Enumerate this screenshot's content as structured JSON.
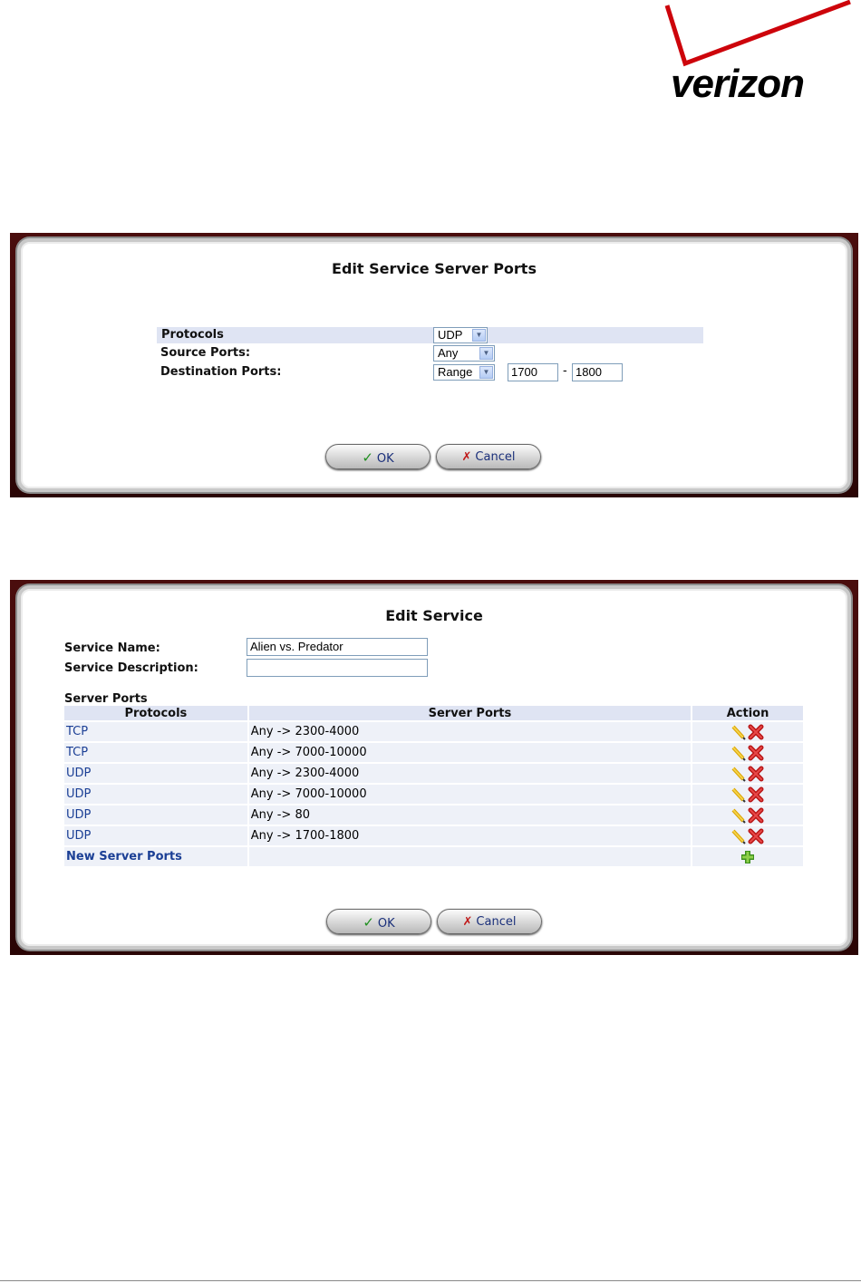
{
  "logo": {
    "text": "verizon"
  },
  "dialog1": {
    "title": "Edit Service Server Ports",
    "protocols_label": "Protocols",
    "protocol_value": "UDP",
    "source_ports_label": "Source Ports:",
    "source_ports_value": "Any",
    "destination_ports_label": "Destination Ports:",
    "destination_ports_value": "Range",
    "range_from": "1700",
    "range_separator": "-",
    "range_to": "1800",
    "ok_label": "OK",
    "cancel_label": "Cancel"
  },
  "dialog2": {
    "title": "Edit Service",
    "service_name_label": "Service Name:",
    "service_name_value": "Alien vs. Predator",
    "service_description_label": "Service Description:",
    "service_description_value": "",
    "server_ports_heading": "Server Ports",
    "columns": [
      "Protocols",
      "Server Ports",
      "Action"
    ],
    "rows": [
      {
        "protocol": "TCP",
        "ports": "Any -> 2300-4000"
      },
      {
        "protocol": "TCP",
        "ports": "Any -> 7000-10000"
      },
      {
        "protocol": "UDP",
        "ports": "Any -> 2300-4000"
      },
      {
        "protocol": "UDP",
        "ports": "Any -> 7000-10000"
      },
      {
        "protocol": "UDP",
        "ports": "Any -> 80"
      },
      {
        "protocol": "UDP",
        "ports": "Any -> 1700-1800"
      }
    ],
    "new_server_ports_label": "New Server Ports",
    "ok_label": "OK",
    "cancel_label": "Cancel"
  },
  "colors": {
    "panel_frame": "#4a0d0d",
    "link": "#1b3f95",
    "row_bg": "#eef1f8",
    "logo_red": "#cd040b"
  },
  "icons": {
    "ok": "check-icon",
    "cancel": "x-icon",
    "edit": "pencil-icon",
    "delete": "delete-icon",
    "add": "plus-icon",
    "dropdown": "chevron-down-icon"
  }
}
